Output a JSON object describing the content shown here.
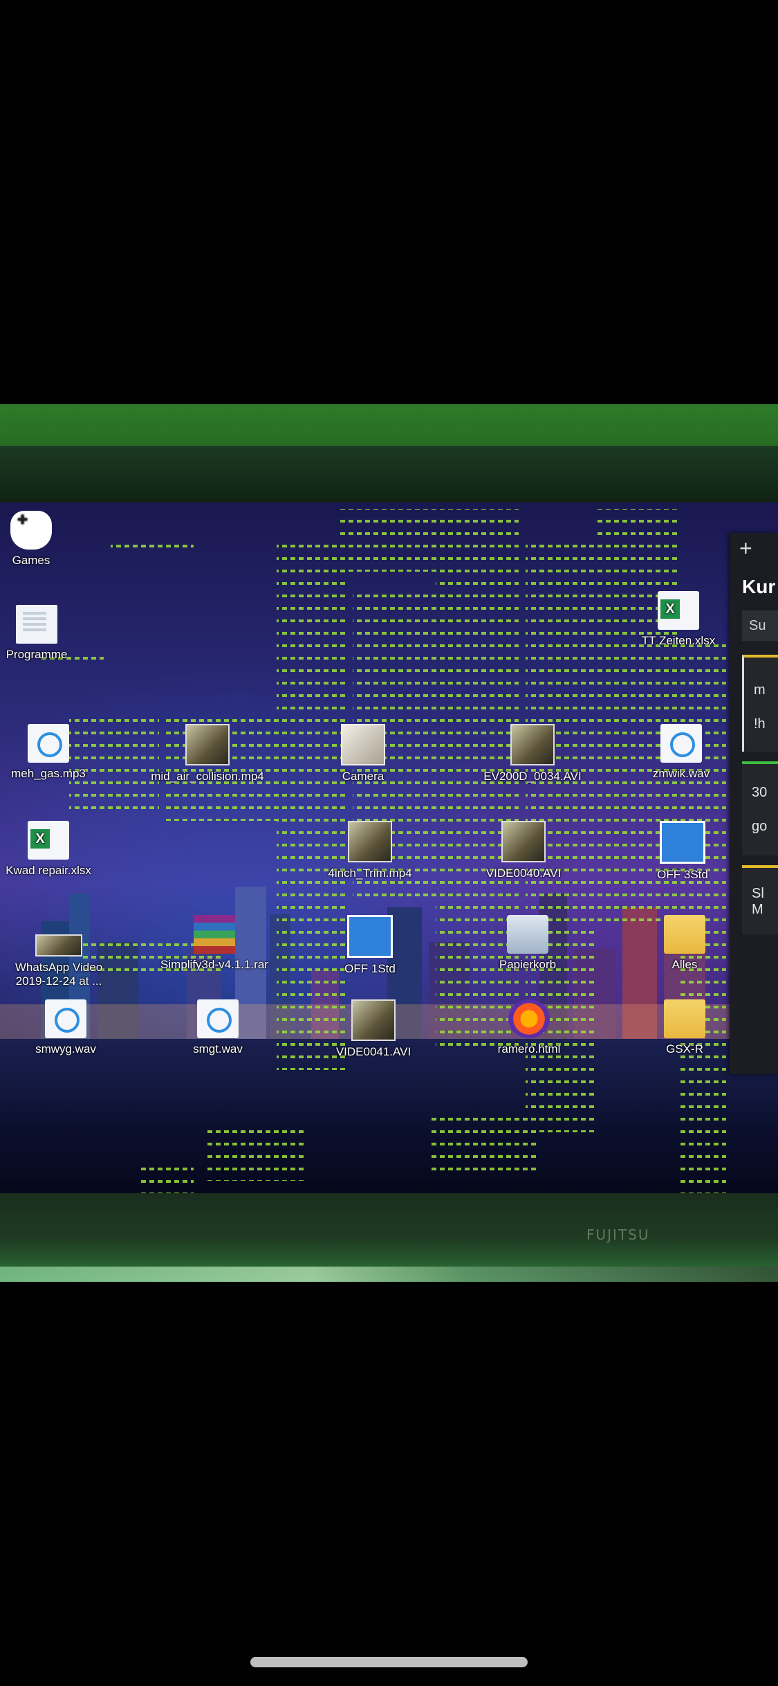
{
  "monitor": {
    "brand": "FUJITSU"
  },
  "desktop_icons": [
    {
      "id": "games",
      "label": "Games",
      "icon": "controller-icon"
    },
    {
      "id": "programme",
      "label": "Programme",
      "icon": "program-icon"
    },
    {
      "id": "tt-zeiten",
      "label": "TT Zeiten.xlsx",
      "icon": "excel-icon"
    },
    {
      "id": "meh-gas",
      "label": "meh_gas.mp3",
      "icon": "media-icon"
    },
    {
      "id": "mid-air",
      "label": "mid_air_collision.mp4",
      "icon": "video-icon"
    },
    {
      "id": "camera",
      "label": "Camera",
      "icon": "camera-icon"
    },
    {
      "id": "ev200d",
      "label": "EV200D_0034.AVI",
      "icon": "video-icon"
    },
    {
      "id": "zmwik",
      "label": "zmwik.wav",
      "icon": "media-icon"
    },
    {
      "id": "kwad",
      "label": "Kwad repair.xlsx",
      "icon": "excel-icon"
    },
    {
      "id": "4inch",
      "label": "4inch_Trim.mp4",
      "icon": "video-icon"
    },
    {
      "id": "vide0040",
      "label": "VIDE0040.AVI",
      "icon": "video-icon"
    },
    {
      "id": "off3std",
      "label": "OFF 3Std",
      "icon": "exe-icon"
    },
    {
      "id": "whatsapp",
      "label": "WhatsApp Video 2019-12-24 at ...",
      "icon": "video-icon"
    },
    {
      "id": "simplify",
      "label": "Simplify3d-v4.1.1.rar",
      "icon": "rar-icon"
    },
    {
      "id": "off1std",
      "label": "OFF 1Std",
      "icon": "exe-icon"
    },
    {
      "id": "papierkorb",
      "label": "Papierkorb",
      "icon": "recycle-bin-icon"
    },
    {
      "id": "alles",
      "label": "Alles",
      "icon": "folder-icon"
    },
    {
      "id": "smwyg",
      "label": "smwyg.wav",
      "icon": "media-icon"
    },
    {
      "id": "smgt",
      "label": "smgt.wav",
      "icon": "media-icon"
    },
    {
      "id": "vide0041",
      "label": "VIDE0041.AVI",
      "icon": "video-icon"
    },
    {
      "id": "ramero",
      "label": "ramero.html",
      "icon": "firefox-icon"
    },
    {
      "id": "gsxr",
      "label": "GSX-R",
      "icon": "folder-icon"
    }
  ],
  "taskbar": {
    "items": [
      "start-icon",
      "task-view-icon",
      "firefox-icon",
      "outlook-icon",
      "file-explorer-icon",
      "whatsapp-icon",
      "sticky-notes-icon"
    ]
  },
  "panel": {
    "plus": "+",
    "title": "Kur",
    "search": "Su",
    "cards": [
      {
        "line1": "m",
        "line2": "!h"
      },
      {
        "line1": "30",
        "line2": "go"
      },
      {
        "line1": "Sl",
        "line2": "M"
      }
    ]
  },
  "colors": {
    "matrix_green": "#9be03a",
    "accent_yellow": "#e2b92c",
    "taskbar_active": "#e58a2a"
  }
}
